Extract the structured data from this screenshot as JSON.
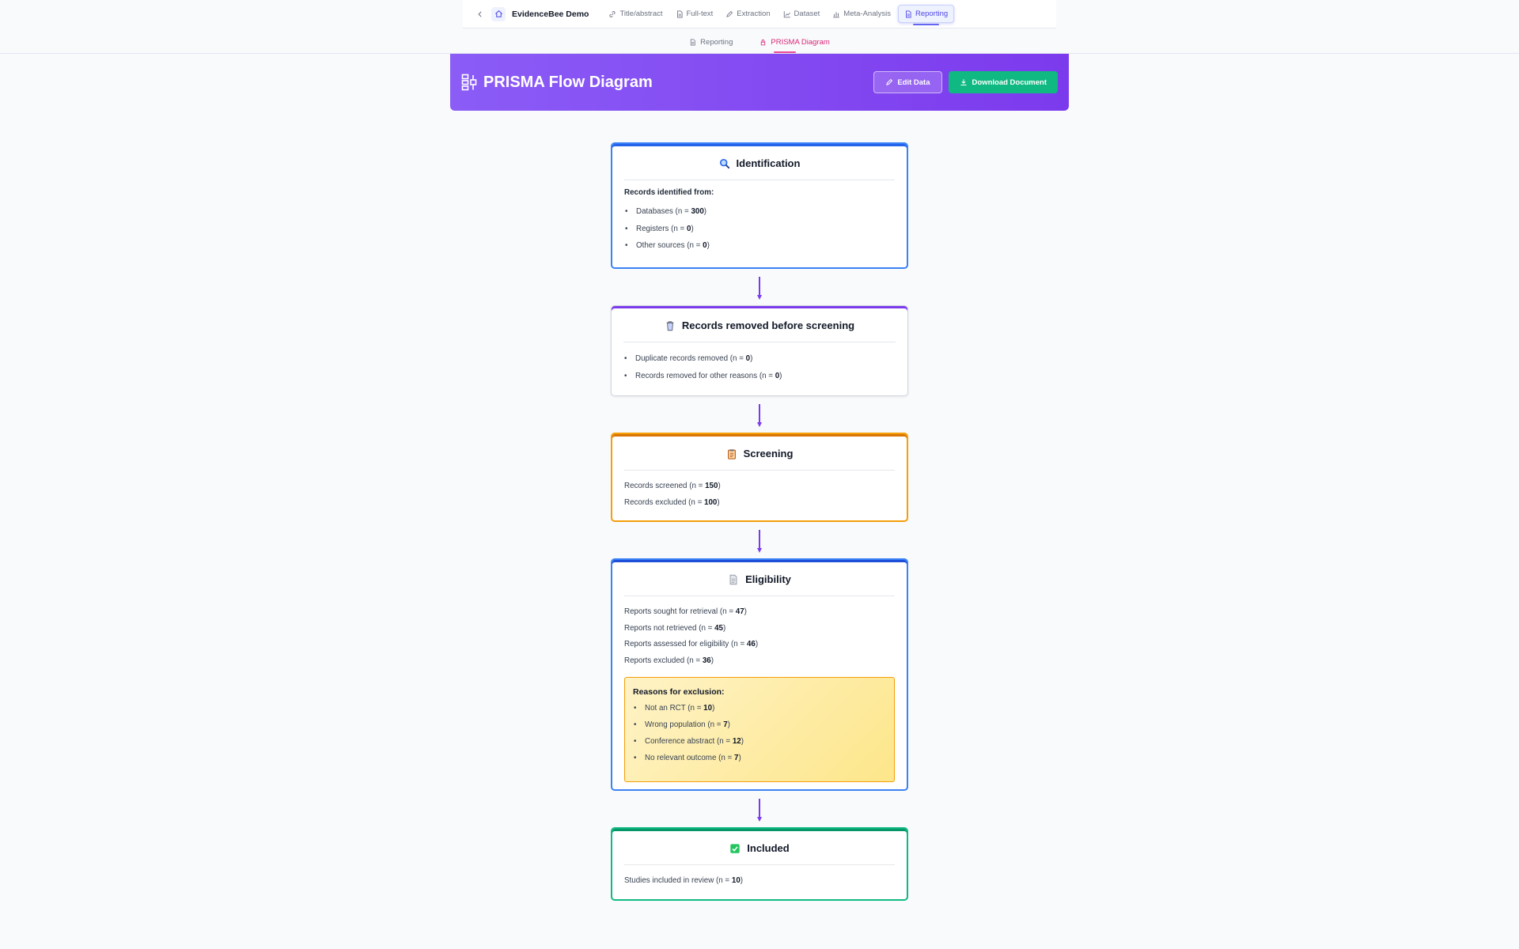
{
  "nav": {
    "project_title": "EvidenceBee Demo",
    "items": [
      {
        "label": "Title/abstract",
        "icon": "link-icon"
      },
      {
        "label": "Full-text",
        "icon": "document-icon"
      },
      {
        "label": "Extraction",
        "icon": "pen-icon"
      },
      {
        "label": "Dataset",
        "icon": "chart-icon"
      },
      {
        "label": "Meta-Analysis",
        "icon": "bar-chart-icon"
      },
      {
        "label": "Reporting",
        "icon": "document-icon"
      }
    ],
    "active_item": "Reporting"
  },
  "subnav": {
    "tabs": [
      {
        "label": "Reporting",
        "icon": "document-icon"
      },
      {
        "label": "PRISMA Diagram",
        "icon": "lock-icon"
      }
    ],
    "active_tab": "PRISMA Diagram"
  },
  "header": {
    "title": "PRISMA Flow Diagram",
    "edit_label": "Edit Data",
    "download_label": "Download Document"
  },
  "colors": {
    "banner": "#7c3aed",
    "download_button": "#10b981",
    "identification_border": "#3b82f6",
    "screening_border": "#f59e0b",
    "included_border": "#10b981",
    "arrow": "#7c3aed"
  },
  "identification": {
    "title": "Identification",
    "icon": "magnifier-icon",
    "sub_head": "Records identified from:",
    "items": [
      {
        "label": "Databases (n = ",
        "value": "300",
        "suffix": ")"
      },
      {
        "label": "Registers (n = ",
        "value": "0",
        "suffix": ")"
      },
      {
        "label": "Other sources (n = ",
        "value": "0",
        "suffix": ")"
      }
    ]
  },
  "removed": {
    "title": "Records removed before screening",
    "icon": "trash-icon",
    "items": [
      {
        "label": "Duplicate records removed (n = ",
        "value": "0",
        "suffix": ")"
      },
      {
        "label": "Records removed for other reasons (n = ",
        "value": "0",
        "suffix": ")"
      }
    ]
  },
  "screening": {
    "title": "Screening",
    "icon": "clipboard-icon",
    "lines": [
      {
        "label": "Records screened (n = ",
        "value": "150",
        "suffix": ")"
      },
      {
        "label": "Records excluded (n = ",
        "value": "100",
        "suffix": ")"
      }
    ]
  },
  "eligibility": {
    "title": "Eligibility",
    "icon": "page-icon",
    "lines": [
      {
        "label": "Reports sought for retrieval (n = ",
        "value": "47",
        "suffix": ")"
      },
      {
        "label": "Reports not retrieved (n = ",
        "value": "45",
        "suffix": ")"
      },
      {
        "label": "Reports assessed for eligibility (n = ",
        "value": "46",
        "suffix": ")"
      },
      {
        "label": "Reports excluded (n = ",
        "value": "36",
        "suffix": ")"
      }
    ],
    "reasons_head": "Reasons for exclusion:",
    "reasons": [
      {
        "label": "Not an RCT (n = ",
        "value": "10",
        "suffix": ")"
      },
      {
        "label": "Wrong population (n = ",
        "value": "7",
        "suffix": ")"
      },
      {
        "label": "Conference abstract (n = ",
        "value": "12",
        "suffix": ")"
      },
      {
        "label": "No relevant outcome (n = ",
        "value": "7",
        "suffix": ")"
      }
    ]
  },
  "included": {
    "title": "Included",
    "icon": "checkmark-icon",
    "lines": [
      {
        "label": "Studies included in review (n = ",
        "value": "10",
        "suffix": ")"
      }
    ]
  }
}
